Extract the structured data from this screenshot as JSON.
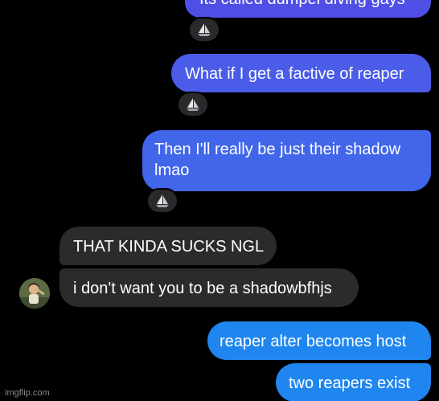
{
  "messages": {
    "m1": "Its called dumpel diving gays",
    "m2": "What if I get a factive of reaper",
    "m3_line1": "Then I'll really be just their shadow",
    "m3_line2": "lmao",
    "m4": "THAT KINDA SUCKS NGL",
    "m5": "i don't want you to be a shadowbfhjs",
    "m6": "reaper alter becomes host",
    "m7": "two reapers exist"
  },
  "reaction_icon": "sailboat-icon",
  "watermark": "imgflip.com",
  "colors": {
    "background": "#000000",
    "outgoing_top": "#4f4fe6",
    "outgoing_bottom": "#1f86f0",
    "incoming": "#2b2b2d"
  }
}
